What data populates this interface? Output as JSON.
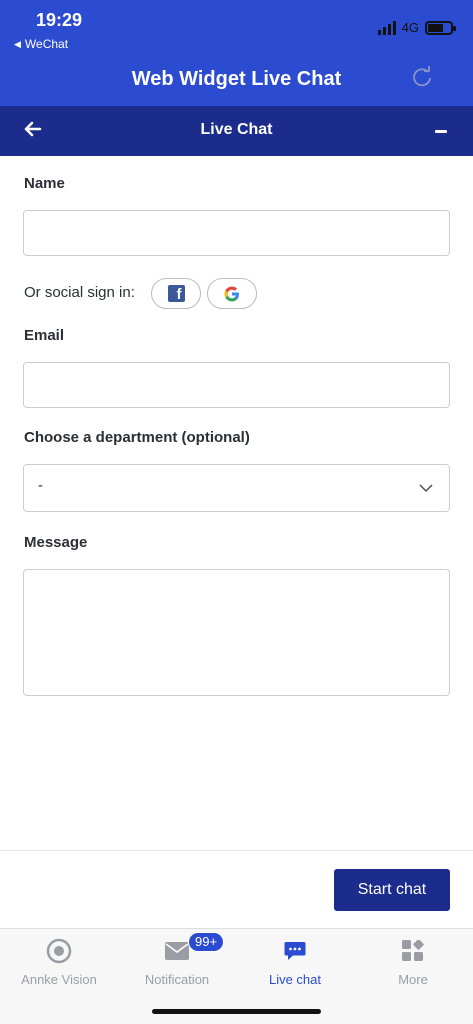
{
  "status_bar": {
    "time": "19:29",
    "back_app": "WeChat",
    "network": "4G"
  },
  "app_header": {
    "title": "Web Widget Live Chat"
  },
  "widget_header": {
    "title": "Live Chat"
  },
  "form": {
    "name_label": "Name",
    "name_value": "",
    "social_label": "Or social sign in:",
    "email_label": "Email",
    "email_value": "",
    "department_label": "Choose a department (optional)",
    "department_selected": "-",
    "message_label": "Message",
    "message_value": ""
  },
  "actions": {
    "start_chat": "Start chat"
  },
  "tabbar": {
    "tabs": [
      {
        "label": "Annke Vision",
        "icon": "annke-vision-icon"
      },
      {
        "label": "Notification",
        "icon": "mail-icon"
      },
      {
        "label": "Live chat",
        "icon": "chat-icon"
      },
      {
        "label": "More",
        "icon": "more-grid-icon"
      }
    ],
    "notification_badge": "99+",
    "active_color": "#2b4bd1"
  },
  "colors": {
    "header_blue": "#2b4bd1",
    "widget_navy": "#1c2c8c",
    "facebook": "#3b5998"
  }
}
